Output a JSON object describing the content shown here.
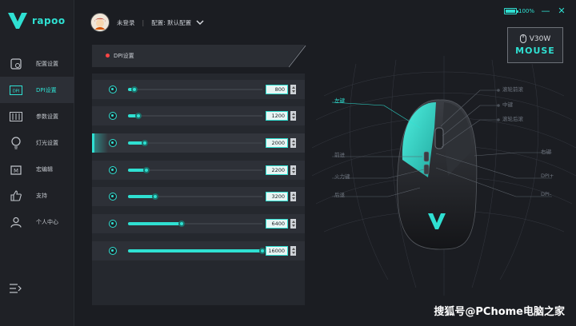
{
  "app": {
    "brand": "rapoo",
    "colors": {
      "accent": "#2fe0d2",
      "background": "#1b1d22",
      "sidebar": "#1f2126",
      "alert": "#ff4545"
    }
  },
  "sidebar": {
    "items": [
      {
        "label": "配置设置",
        "icon": "profile-settings-icon",
        "active": false
      },
      {
        "label": "DPI设置",
        "icon": "dpi-icon",
        "active": true
      },
      {
        "label": "参数设置",
        "icon": "parameters-icon",
        "active": false
      },
      {
        "label": "灯光设置",
        "icon": "lightbulb-icon",
        "active": false
      },
      {
        "label": "宏编辑",
        "icon": "macro-icon",
        "active": false
      },
      {
        "label": "支持",
        "icon": "thumbs-up-icon",
        "active": false
      },
      {
        "label": "个人中心",
        "icon": "user-icon",
        "active": false
      }
    ],
    "collapse_icon": "collapse-menu-icon"
  },
  "header": {
    "user_name": "未登录",
    "separator": "|",
    "config_label": "配置: 默认配置",
    "battery_text": "100%",
    "battery_level": 1.0
  },
  "device": {
    "model": "V30W",
    "type": "MOUSE"
  },
  "dpi_panel": {
    "title": "DPI设置",
    "max_dpi": 16000,
    "rows": [
      {
        "value": "800",
        "dpi": 800,
        "active": false
      },
      {
        "value": "1200",
        "dpi": 1200,
        "active": false
      },
      {
        "value": "2000",
        "dpi": 2000,
        "active": true
      },
      {
        "value": "2200",
        "dpi": 2200,
        "active": false
      },
      {
        "value": "3200",
        "dpi": 3200,
        "active": false
      },
      {
        "value": "6400",
        "dpi": 6400,
        "active": false
      },
      {
        "value": "16000",
        "dpi": 16000,
        "active": false
      }
    ]
  },
  "mouse_labels": {
    "left": [
      {
        "text": "左键",
        "active": true
      },
      {
        "text": "前进",
        "active": false
      },
      {
        "text": "火力键",
        "active": false
      },
      {
        "text": "后退",
        "active": false
      }
    ],
    "right": [
      {
        "text": "滚轮前滚",
        "active": false
      },
      {
        "text": "中键",
        "active": false
      },
      {
        "text": "滚轮后滚",
        "active": false
      },
      {
        "text": "右键",
        "active": false
      },
      {
        "text": "DPI+",
        "active": false
      },
      {
        "text": "DPI-",
        "active": false
      }
    ]
  },
  "watermark": "搜狐号@PChome电脑之家"
}
